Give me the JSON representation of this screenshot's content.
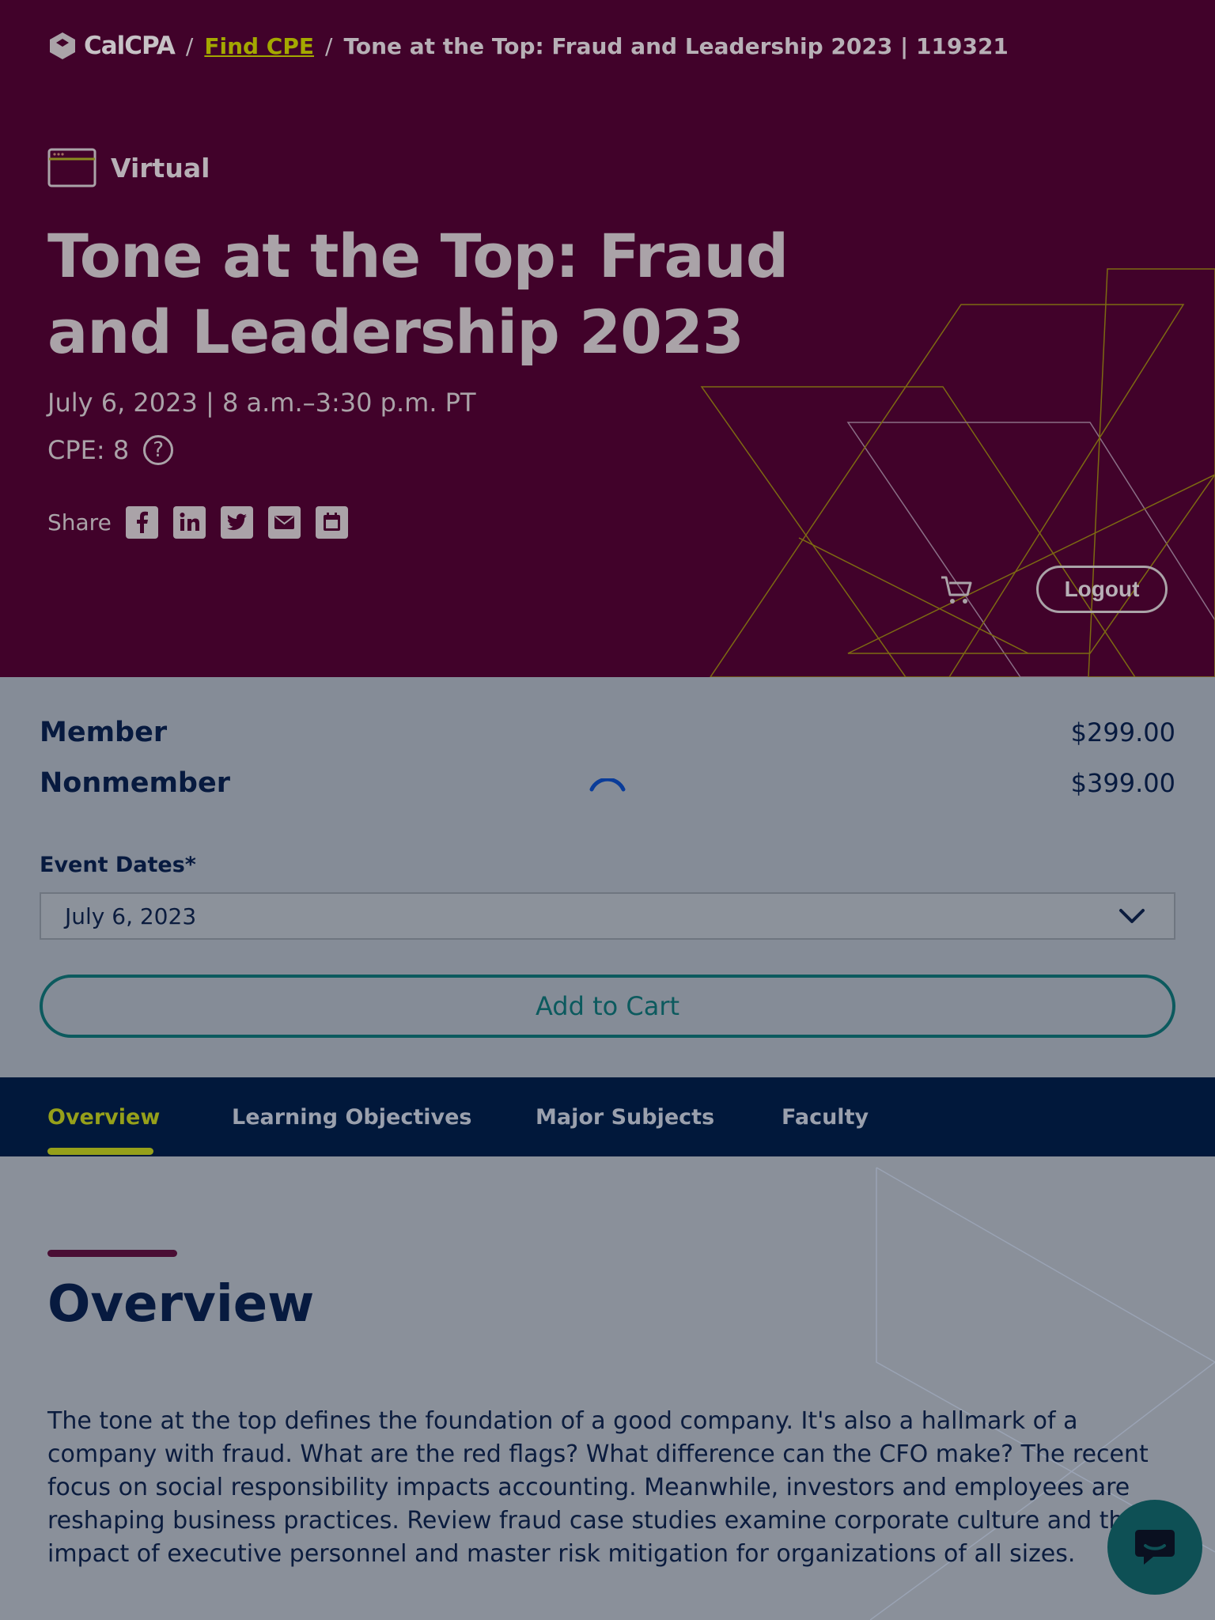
{
  "breadcrumb": {
    "logo_text": "CalCPA",
    "sep1": "/",
    "find_cpe": "Find CPE",
    "sep2": "/",
    "current": "Tone at the Top: Fraud and Leadership 2023 | 119321"
  },
  "event": {
    "format": "Virtual",
    "format_icon": "browser-window-icon",
    "title": "Tone at the Top: Fraud and Leadership 2023",
    "date_time": "July 6, 2023 | 8 a.m.–3:30 p.m. PT",
    "cpe": "CPE: 8",
    "help_glyph": "?"
  },
  "share": {
    "label": "Share",
    "icons": [
      "facebook-icon",
      "linkedin-icon",
      "twitter-icon",
      "email-icon",
      "calendar-icon"
    ]
  },
  "header_actions": {
    "cart_icon": "cart-icon",
    "logout_label": "Logout"
  },
  "pricing": {
    "rows": [
      {
        "label": "Member",
        "price": "$299.00"
      },
      {
        "label": "Nonmember",
        "price": "$399.00"
      }
    ]
  },
  "registration": {
    "dates_label": "Event Dates*",
    "selected_date": "July 6, 2023",
    "add_to_cart_label": "Add to Cart"
  },
  "tabs": [
    {
      "label": "Overview",
      "active": true
    },
    {
      "label": "Learning Objectives",
      "active": false
    },
    {
      "label": "Major Subjects",
      "active": false
    },
    {
      "label": "Faculty",
      "active": false
    }
  ],
  "overview": {
    "title": "Overview",
    "text": "The tone at the top defines the foundation of a good company. It's also a hallmark of a company with fraud. What are the red flags? What difference can the CFO make? The recent focus on social responsibility impacts accounting. Meanwhile, investors and employees are reshaping business practices. Review fraud case studies examine corporate culture and the impact of executive personnel and master risk mitigation for organizations of all sizes."
  },
  "colors": {
    "hero_bg": "#41022a",
    "accent_lime": "#96a01a",
    "navy": "#01183b",
    "teal": "#0c5a5e"
  }
}
